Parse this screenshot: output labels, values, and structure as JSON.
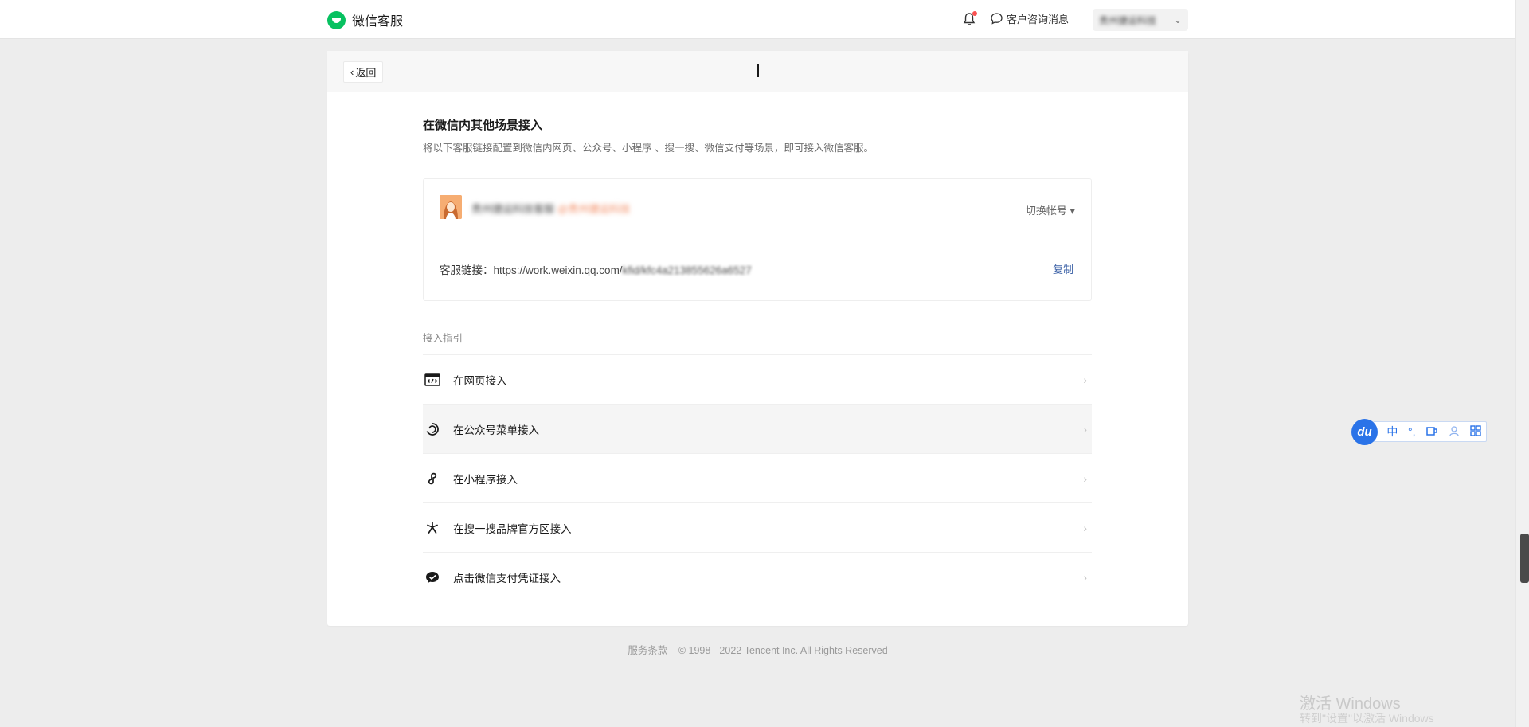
{
  "topbar": {
    "brand": "微信客服",
    "consult_label": "客户咨询消息",
    "account_name": "贵州捷运科技",
    "icons": [
      "wechat-logo-icon",
      "bell-icon",
      "chat-bubble-icon",
      "chevron-down-icon"
    ],
    "colors": {
      "brand": "#07c160",
      "notification_dot": "#fa5151"
    }
  },
  "card": {
    "back_label": "返回",
    "title": "在微信内其他场景接入",
    "subtitle": "将以下客服链接配置到微信内网页、公众号、小程序 、搜一搜、微信支付等场景，即可接入微信客服。",
    "account": {
      "name": "贵州捷运科技客服",
      "org": "@贵州捷运科技",
      "switch_label": "切换帐号 ▾"
    },
    "link": {
      "label": "客服链接：",
      "url_visible": "https://work.weixin.qq.com/",
      "url_masked": "kfid/kfc4a213855626a6527",
      "copy_label": "复制"
    },
    "guide_label": "接入指引",
    "guide_items": [
      {
        "label": "在网页接入",
        "icon": "webpage-code-icon"
      },
      {
        "label": "在公众号菜单接入",
        "icon": "official-account-icon"
      },
      {
        "label": "在小程序接入",
        "icon": "mini-program-icon"
      },
      {
        "label": "在搜一搜品牌官方区接入",
        "icon": "search-sparkle-icon"
      },
      {
        "label": "点击微信支付凭证接入",
        "icon": "wechat-pay-icon"
      }
    ]
  },
  "footer": {
    "terms": "服务条款",
    "copyright": "© 1998 - 2022 Tencent Inc. All Rights Reserved"
  },
  "ime": {
    "logo": "du",
    "mode": "中",
    "punct": "°,",
    "icons": [
      "ime-baidu-logo-icon",
      "cup-icon",
      "user-icon",
      "grid-icon"
    ]
  },
  "watermark": {
    "line1": "激活 Windows",
    "line2": "转到\"设置\"以激活 Windows"
  }
}
